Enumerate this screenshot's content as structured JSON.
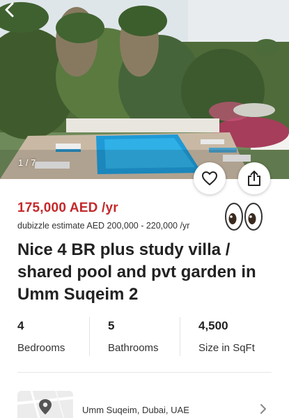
{
  "gallery": {
    "counter": "1 / 7"
  },
  "listing": {
    "price": "175,000 AED /yr",
    "estimate": "dubizzle estimate AED 200,000 - 220,000 /yr",
    "title": "Nice 4 BR plus study villa / shared pool and pvt garden in Umm Suqeim 2"
  },
  "stats": [
    {
      "value": "4",
      "label": "Bedrooms"
    },
    {
      "value": "5",
      "label": "Bathrooms"
    },
    {
      "value": "4,500",
      "label": "Size in SqFt"
    }
  ],
  "location": {
    "text": "Umm Suqeim, Dubai, UAE"
  },
  "colors": {
    "price": "#c4282a",
    "pool": "#1f9ad6",
    "white": "#ffffff"
  },
  "icons": [
    "back-arrow-icon",
    "heart-icon",
    "share-icon",
    "eyes-emoji-icon",
    "map-pin-icon",
    "chevron-right-icon"
  ]
}
